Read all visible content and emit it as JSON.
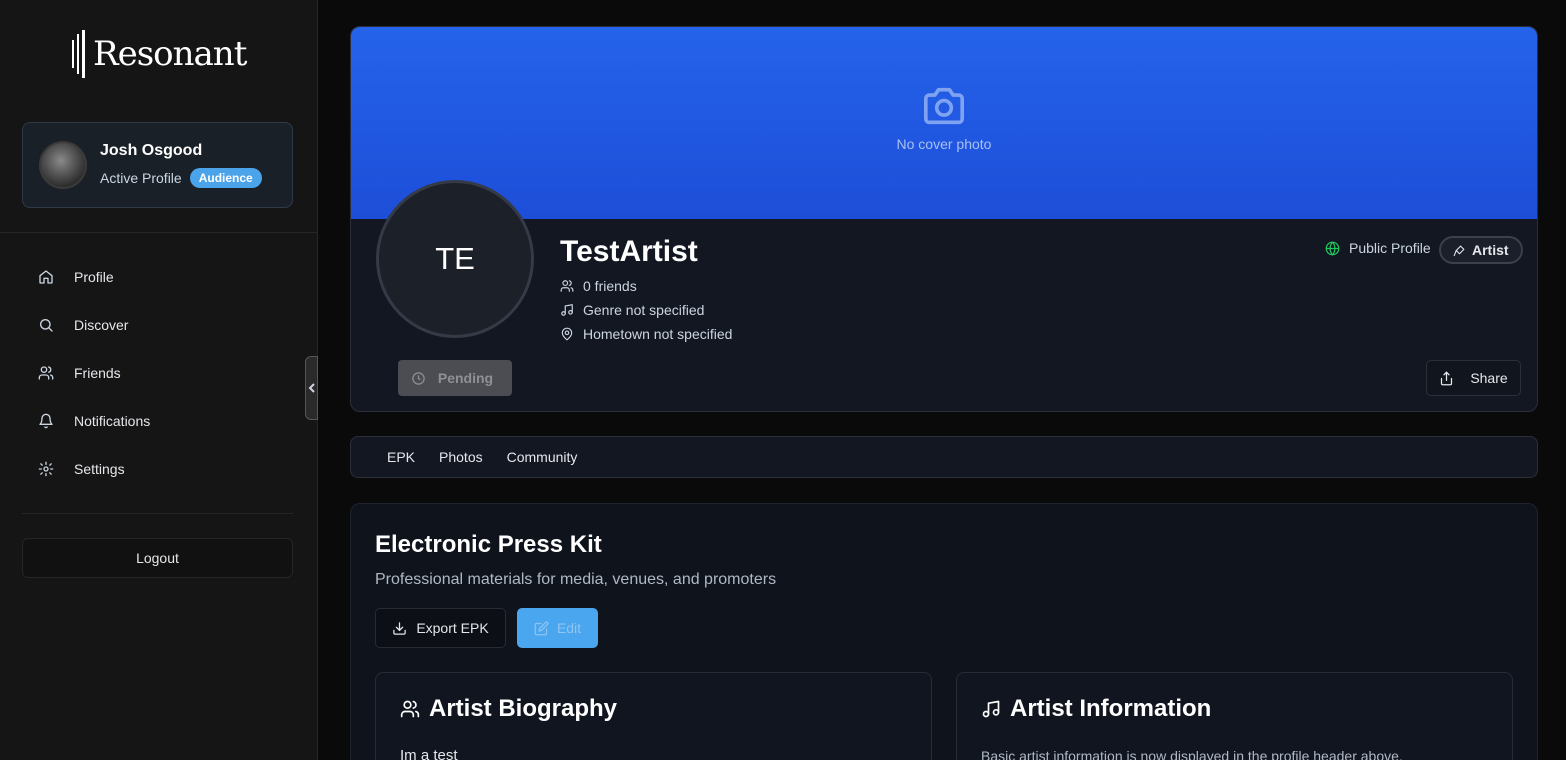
{
  "sidebar": {
    "logo_text": "Resonant",
    "user": {
      "name": "Josh Osgood",
      "status": "Active Profile",
      "badge": "Audience"
    },
    "nav": [
      {
        "label": "Profile",
        "icon": "home-icon"
      },
      {
        "label": "Discover",
        "icon": "search-icon"
      },
      {
        "label": "Friends",
        "icon": "users-icon"
      },
      {
        "label": "Notifications",
        "icon": "bell-icon"
      },
      {
        "label": "Settings",
        "icon": "gear-icon"
      }
    ],
    "logout_label": "Logout"
  },
  "header": {
    "cover_text": "No cover photo",
    "initials": "TE",
    "artist_name": "TestArtist",
    "friends": "0 friends",
    "genre": "Genre not specified",
    "hometown": "Hometown not specified",
    "pending_label": "Pending",
    "visibility": "Public Profile",
    "role_badge": "Artist",
    "share_label": "Share"
  },
  "tabs": [
    "EPK",
    "Photos",
    "Community"
  ],
  "epk": {
    "title": "Electronic Press Kit",
    "subtitle": "Professional materials for media, venues, and promoters",
    "export_label": "Export EPK",
    "edit_label": "Edit",
    "biography": {
      "title": "Artist Biography",
      "text": "Im a test"
    },
    "information": {
      "title": "Artist Information",
      "text": "Basic artist information is now displayed in the profile header above."
    }
  },
  "colors": {
    "accent": "#4ba3ea",
    "cover": "#2563eb",
    "public": "#22c55e"
  }
}
